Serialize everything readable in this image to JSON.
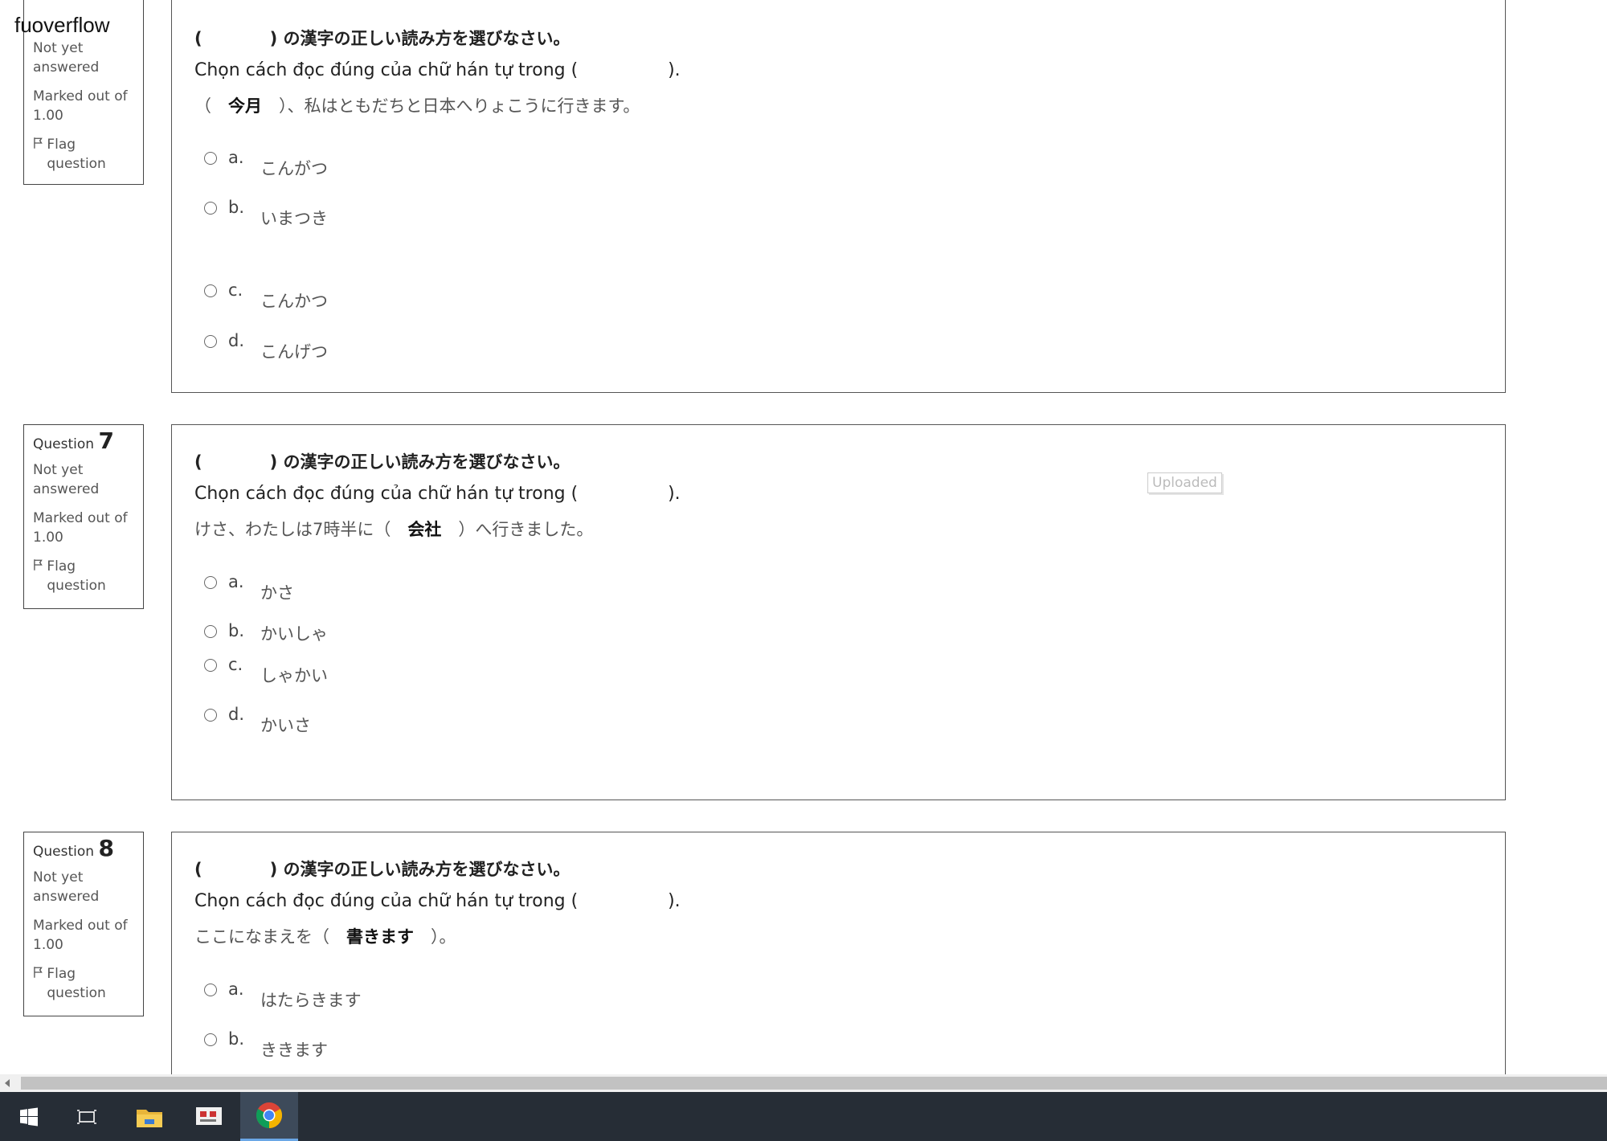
{
  "watermark": "fuoverflow",
  "top_panel": {
    "status": "Not yet answered",
    "marked_label": "Marked out of",
    "mark": "1.00",
    "flag_label": "Flag question"
  },
  "questions": [
    {
      "instruction_jp": "(　　　　) の漢字の正しい読み方を選びなさい。",
      "instruction_vi": "Chọn cách đọc đúng của chữ hán tự trong (                ).",
      "sentence_pre": "（　",
      "sentence_word": "今月",
      "sentence_post": "　）、私はともだちと日本へりょこうに行きます。",
      "options": [
        {
          "letter": "a.",
          "text": "こんがつ"
        },
        {
          "letter": "b.",
          "text": "いまつき"
        },
        {
          "letter": "c.",
          "text": "こんかつ"
        },
        {
          "letter": "d.",
          "text": "こんげつ"
        }
      ]
    },
    {
      "qlabel": "Question",
      "qnum": "7",
      "status": "Not yet answered",
      "marked_label": "Marked out of",
      "mark": "1.00",
      "flag_label": "Flag question",
      "instruction_jp": "(　　　　) の漢字の正しい読み方を選びなさい。",
      "instruction_vi": "Chọn cách đọc đúng của chữ hán tự trong (                ).",
      "sentence_pre": "けさ、わたしは7時半に（　",
      "sentence_word": "会社",
      "sentence_post": "　）へ行きました。",
      "options": [
        {
          "letter": "a.",
          "text": "かさ"
        },
        {
          "letter": "b.",
          "text": "かいしゃ"
        },
        {
          "letter": "c.",
          "text": "しゃかい"
        },
        {
          "letter": "d.",
          "text": "かいさ"
        }
      ]
    },
    {
      "qlabel": "Question",
      "qnum": "8",
      "status": "Not yet answered",
      "marked_label": "Marked out of",
      "mark": "1.00",
      "flag_label": "Flag question",
      "instruction_jp": "(　　　　) の漢字の正しい読み方を選びなさい。",
      "instruction_vi": "Chọn cách đọc đúng của chữ hán tự trong (                ).",
      "sentence_pre": "ここになまえを（　",
      "sentence_word": "書きます",
      "sentence_post": "　）。",
      "options": [
        {
          "letter": "a.",
          "text": "はたらきます"
        },
        {
          "letter": "b.",
          "text": "ききます"
        }
      ]
    }
  ],
  "uploaded_label": "Uploaded",
  "taskbar": {
    "icons": [
      "windows-start-icon",
      "task-view-icon",
      "file-explorer-icon",
      "app-icon",
      "chrome-icon"
    ],
    "active": "chrome-icon"
  }
}
